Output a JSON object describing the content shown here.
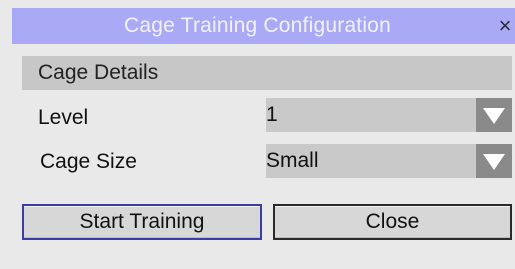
{
  "window": {
    "title": "Cage Training Configuration",
    "close_glyph": "×"
  },
  "section": {
    "title": "Cage Details"
  },
  "fields": {
    "level": {
      "label": "Level",
      "value": "1"
    },
    "cage_size": {
      "label": "Cage Size",
      "value": "Small"
    }
  },
  "buttons": {
    "start": "Start Training",
    "close": "Close"
  },
  "icons": {
    "dropdown": "chevron-down-icon",
    "close": "close-icon"
  },
  "colors": {
    "titlebar": "#a9a9f5",
    "panel": "#e9e9e9",
    "section": "#c7c7c7",
    "dropdown_arrow_bg": "#8a8a8a",
    "primary_button_border": "#3c3ca6"
  }
}
